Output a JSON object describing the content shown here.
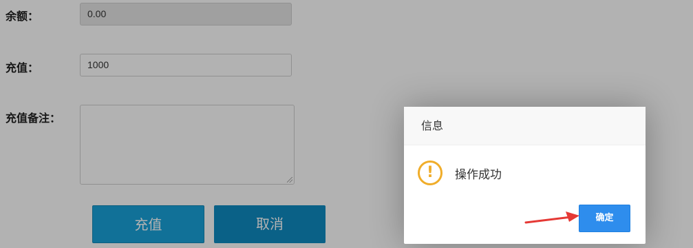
{
  "form": {
    "balance_label": "余额：",
    "balance_value": "0.00",
    "recharge_label": "充值：",
    "recharge_value": "1000",
    "remark_label": "充值备注：",
    "recharge_button": "充值",
    "cancel_button": "取消"
  },
  "dialog": {
    "title": "信息",
    "icon": "warning-icon",
    "message": "操作成功",
    "ok_button": "确定"
  },
  "colors": {
    "primary_button": "#19a2da",
    "dialog_ok": "#2e8ded",
    "warning": "#f0ad2a",
    "arrow": "#e53935"
  }
}
